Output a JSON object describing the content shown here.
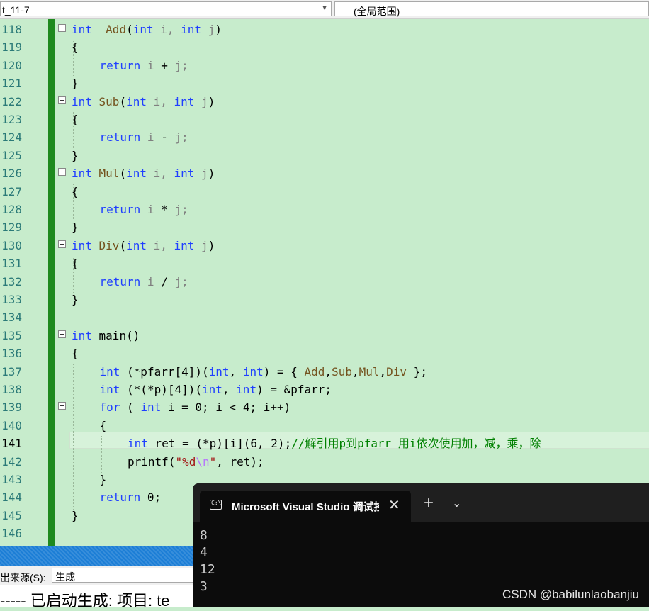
{
  "toolbar": {
    "file_combo": "t_11-7",
    "scope_combo": "(全局范围)"
  },
  "editor": {
    "current_line": "141",
    "lines": [
      {
        "num": "118"
      },
      {
        "num": "119"
      },
      {
        "num": "120"
      },
      {
        "num": "121"
      },
      {
        "num": "122"
      },
      {
        "num": "123"
      },
      {
        "num": "124"
      },
      {
        "num": "125"
      },
      {
        "num": "126"
      },
      {
        "num": "127"
      },
      {
        "num": "128"
      },
      {
        "num": "129"
      },
      {
        "num": "130"
      },
      {
        "num": "131"
      },
      {
        "num": "132"
      },
      {
        "num": "133"
      },
      {
        "num": "134"
      },
      {
        "num": "135"
      },
      {
        "num": "136"
      },
      {
        "num": "137"
      },
      {
        "num": "138"
      },
      {
        "num": "139"
      },
      {
        "num": "140"
      },
      {
        "num": "141"
      },
      {
        "num": "142"
      },
      {
        "num": "143"
      },
      {
        "num": "144"
      },
      {
        "num": "145"
      },
      {
        "num": "146"
      }
    ],
    "code": {
      "l118": [
        "int",
        "  Add",
        "(",
        "int",
        " i, ",
        "int",
        " j",
        ")"
      ],
      "l119": "{",
      "l120": [
        "return",
        " i ",
        "+",
        " j;"
      ],
      "l121": "}",
      "l122": [
        "int",
        " Sub",
        "(",
        "int",
        " i, ",
        "int",
        " j",
        ")"
      ],
      "l123": "{",
      "l124": [
        "return",
        " i ",
        "-",
        " j;"
      ],
      "l125": "}",
      "l126": [
        "int",
        " Mul",
        "(",
        "int",
        " i, ",
        "int",
        " j",
        ")"
      ],
      "l127": "{",
      "l128": [
        "return",
        " i ",
        "*",
        " j;"
      ],
      "l129": "}",
      "l130": [
        "int",
        " Div",
        "(",
        "int",
        " i, ",
        "int",
        " j",
        ")"
      ],
      "l131": "{",
      "l132": [
        "return",
        " i ",
        "/",
        " j;"
      ],
      "l133": "}",
      "l135": [
        "int",
        " main()"
      ],
      "l136": "{",
      "l137": [
        "int",
        " (*pfarr[4])(",
        "int",
        ", ",
        "int",
        ") = { ",
        "Add",
        ",",
        "Sub",
        ",",
        "Mul",
        ",",
        "Div",
        " };"
      ],
      "l138": [
        "int",
        " (*(*p)[4])(",
        "int",
        ", ",
        "int",
        ") = &pfarr;"
      ],
      "l139": [
        "for",
        " ( ",
        "int",
        " i = 0; i < 4; i++)"
      ],
      "l140": "{",
      "l141": [
        "int",
        " ret = (*p)[i](6, 2);",
        "//解引用p到pfarr 用i依次使用加，减，乘，除"
      ],
      "l142": [
        "printf(",
        "\"%d",
        "\\n",
        "\"",
        ", ret);"
      ],
      "l143": "}",
      "l144": [
        "return",
        " 0;"
      ],
      "l145": "}"
    }
  },
  "output_panel": {
    "source_label": "出来源(S):",
    "source_value": "生成",
    "build_text": "----- 已启动生成: 项目: te"
  },
  "terminal": {
    "tab_title": "Microsoft Visual Studio 调试控制台",
    "output": [
      "8",
      "4",
      "12",
      "3"
    ]
  },
  "watermark": "CSDN @babilunlaobanjiu",
  "colors": {
    "editor_bg": "#c7eccc",
    "keyword": "#1f3fff",
    "function": "#74531f",
    "comment": "#008000",
    "string": "#a31515",
    "terminal_bg": "#0c0c0c"
  }
}
